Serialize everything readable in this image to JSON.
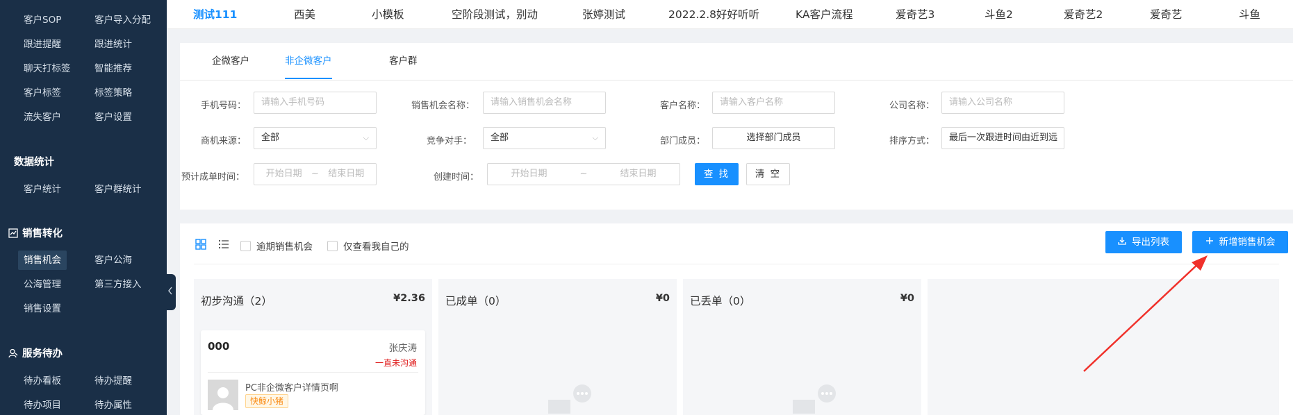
{
  "sidebar": {
    "top_items": [
      [
        "客户SOP",
        "客户导入分配"
      ],
      [
        "跟进提醒",
        "跟进统计"
      ],
      [
        "聊天打标签",
        "智能推荐"
      ],
      [
        "客户标签",
        "标签策略"
      ],
      [
        "流失客户",
        "客户设置"
      ]
    ],
    "group_data_stats": "数据统计",
    "data_stats_items": [
      "客户统计",
      "客户群统计"
    ],
    "group_sales": "销售转化",
    "sales_items": [
      [
        "销售机会",
        "客户公海"
      ],
      [
        "公海管理",
        "第三方接入"
      ],
      [
        "销售设置",
        ""
      ]
    ],
    "group_service": "服务待办",
    "service_items": [
      [
        "待办看板",
        "待办提醒"
      ],
      [
        "待办项目",
        "待办属性"
      ]
    ]
  },
  "top_tabs": [
    "测试111",
    "西美",
    "小模板",
    "空阶段测试，别动",
    "张婷测试",
    "2022.2.8好好听听",
    "KA客户流程",
    "爱奇艺3",
    "斗鱼2",
    "爱奇艺2",
    "爱奇艺",
    "斗鱼"
  ],
  "sub_tabs": [
    "企微客户",
    "非企微客户",
    "客户群"
  ],
  "filters": {
    "phone_label": "手机号码：",
    "phone_placeholder": "请输入手机号码",
    "opportunity_label": "销售机会名称：",
    "opportunity_placeholder": "请输入销售机会名称",
    "customer_label": "客户名称：",
    "customer_placeholder": "请输入客户名称",
    "company_label": "公司名称：",
    "company_placeholder": "请输入公司名称",
    "source_label": "商机来源：",
    "source_value": "全部",
    "competitor_label": "竞争对手：",
    "competitor_value": "全部",
    "dept_label": "部门成员：",
    "dept_button": "选择部门成员",
    "sort_label": "排序方式：",
    "sort_value": "最后一次跟进时间由近到远",
    "expected_label": "预计成单时间：",
    "created_label": "创建时间：",
    "start_date": "开始日期",
    "end_date": "结束日期",
    "range_sep": "~",
    "search_button": "查 找",
    "clear_button": "清 空"
  },
  "toolbar": {
    "overdue_label": "逾期销售机会",
    "mine_label": "仅查看我自己的",
    "export_button": "导出列表",
    "new_button": "新增销售机会"
  },
  "columns": [
    {
      "title": "初步沟通（2）",
      "amount": "¥2.36"
    },
    {
      "title": "已成单（0）",
      "amount": "¥0"
    },
    {
      "title": "已丢单（0）",
      "amount": "¥0"
    }
  ],
  "card": {
    "title": "000",
    "owner": "张庆涛",
    "status": "一直未沟通",
    "description": "PC非企微客户详情页啊",
    "tag": "快鲸小猪"
  },
  "colors": {
    "sidebar_bg": "#1a2f47",
    "accent": "#1890ff",
    "status_red": "#e02020",
    "annotation_arrow": "#f0312b"
  }
}
